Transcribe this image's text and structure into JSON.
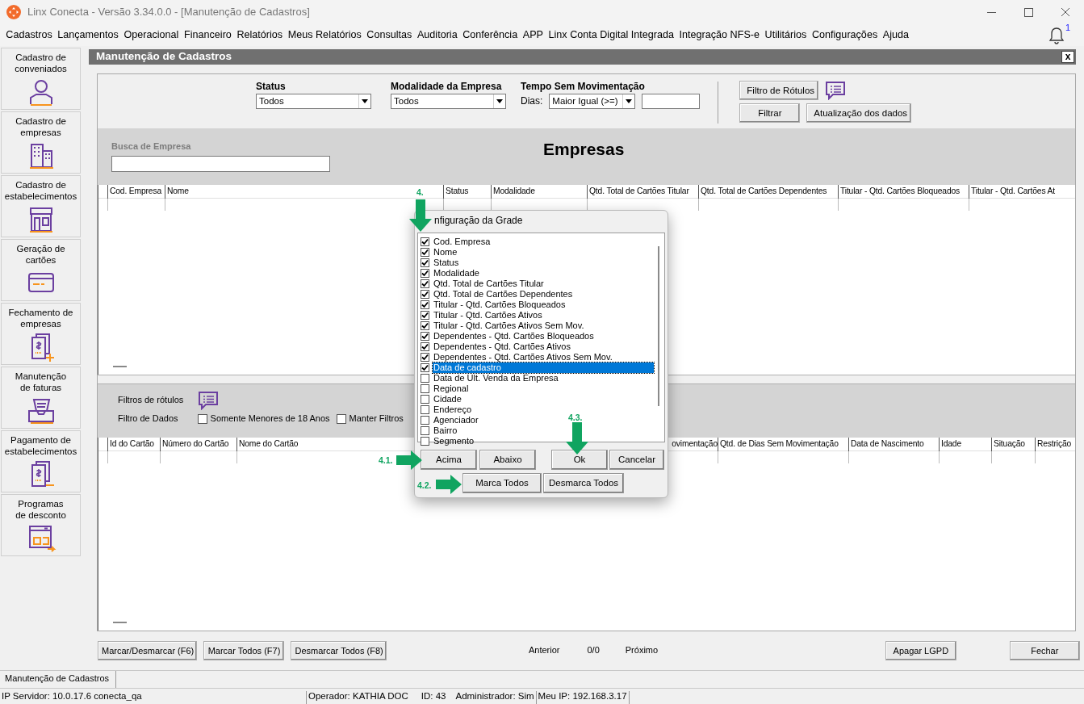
{
  "window": {
    "title": "Linx Conecta - Versão 3.34.0.0 - [Manutenção de Cadastros]"
  },
  "menu": [
    "Cadastros",
    "Lançamentos",
    "Operacional",
    "Financeiro",
    "Relatórios",
    "Meus Relatórios",
    "Consultas",
    "Auditoria",
    "Conferência",
    "APP",
    "Linx Conta Digital Integrada",
    "Integração NFS-e",
    "Utilitários",
    "Configurações",
    "Ajuda"
  ],
  "notifications": {
    "count": "1"
  },
  "sidebar": {
    "items": [
      {
        "label": "Cadastro de\nconveniados",
        "kind": "person"
      },
      {
        "label": "Cadastro de\nempresas",
        "kind": "buildings"
      },
      {
        "label": "Cadastro de\nestabelecimentos",
        "kind": "store"
      },
      {
        "label": "Geração de\ncartões",
        "kind": "card"
      },
      {
        "label": "Fechamento de\nempresas",
        "kind": "invoice-plus"
      },
      {
        "label": "Manutenção\nde faturas",
        "kind": "tray"
      },
      {
        "label": "Pagamento de\nestabelecimentos",
        "kind": "invoice-minus"
      },
      {
        "label": "Programas\nde desconto",
        "kind": "discount"
      }
    ]
  },
  "document": {
    "title": "Manutenção de Cadastros",
    "close": "x"
  },
  "filters": {
    "status": {
      "label": "Status",
      "value": "Todos"
    },
    "modalidade": {
      "label": "Modalidade da Empresa",
      "value": "Todos"
    },
    "tempo": {
      "label": "Tempo Sem Movimentação",
      "dias_label": "Dias:",
      "operator": "Maior Igual (>=)"
    },
    "buttons": [
      "Filtro de Rótulos",
      "Filtrar",
      "Atualização dos dados"
    ]
  },
  "search": {
    "label": "Busca de Empresa"
  },
  "heading": "Empresas",
  "companies_grid": {
    "columns": [
      "Cod. Empresa",
      "Nome",
      "Status",
      "Modalidade",
      "Qtd. Total de Cartões Titular",
      "Qtd. Total de Cartões Dependentes",
      "Titular - Qtd. Cartões Bloqueados",
      "Titular - Qtd. Cartões At"
    ]
  },
  "card_filters": {
    "label": "Filtros de rótulos",
    "data_label": "Filtro de Dados",
    "checkboxes": [
      {
        "label": "Somente Menores de 18 Anos",
        "checked": false
      },
      {
        "label": "Manter Filtros",
        "checked": false
      }
    ]
  },
  "cards_grid": {
    "columns": [
      "Id do Cartão",
      "Número do Cartão",
      "Nome do Cartão",
      "ovimentação",
      "Qtd. de Dias Sem Movimentação",
      "Data de Nascimento",
      "Idade",
      "Situação",
      "Restrição"
    ]
  },
  "footer": {
    "buttons": [
      "Marcar/Desmarcar (F6)",
      "Marcar Todos (F7)",
      "Desmarcar Todos (F8)"
    ],
    "previous": "Anterior",
    "count": "0/0",
    "next": "Próximo",
    "erase": "Apagar LGPD",
    "close": "Fechar"
  },
  "open_tabs": [
    "Manutenção de Cadastros"
  ],
  "status_bar": [
    "IP Servidor: 10.0.17.6 conecta_qa",
    "Operador: KATHIA DOC",
    "ID: 43",
    "Administrador: Sim",
    "Meu IP: 192.168.3.17"
  ],
  "dialog": {
    "title": "nfiguração da Grade",
    "items": [
      {
        "label": "Cod. Empresa",
        "checked": true,
        "selected": false
      },
      {
        "label": "Nome",
        "checked": true,
        "selected": false
      },
      {
        "label": "Status",
        "checked": true,
        "selected": false
      },
      {
        "label": "Modalidade",
        "checked": true,
        "selected": false
      },
      {
        "label": "Qtd. Total de Cartões Titular",
        "checked": true,
        "selected": false
      },
      {
        "label": "Qtd. Total de Cartões Dependentes",
        "checked": true,
        "selected": false
      },
      {
        "label": "Titular - Qtd. Cartões Bloqueados",
        "checked": true,
        "selected": false
      },
      {
        "label": "Titular - Qtd. Cartões Ativos",
        "checked": true,
        "selected": false
      },
      {
        "label": "Titular - Qtd. Cartões Ativos Sem Mov.",
        "checked": true,
        "selected": false
      },
      {
        "label": "Dependentes - Qtd. Cartões Bloqueados",
        "checked": true,
        "selected": false
      },
      {
        "label": "Dependentes - Qtd. Cartões Ativos",
        "checked": true,
        "selected": false
      },
      {
        "label": "Dependentes - Qtd. Cartões Ativos Sem Mov.",
        "checked": true,
        "selected": false
      },
      {
        "label": "Data de cadastro",
        "checked": true,
        "selected": true
      },
      {
        "label": "Data de Ult. Venda da Empresa",
        "checked": false,
        "selected": false
      },
      {
        "label": "Regional",
        "checked": false,
        "selected": false
      },
      {
        "label": "Cidade",
        "checked": false,
        "selected": false
      },
      {
        "label": "Endereço",
        "checked": false,
        "selected": false
      },
      {
        "label": "Agenciador",
        "checked": false,
        "selected": false
      },
      {
        "label": "Bairro",
        "checked": false,
        "selected": false
      },
      {
        "label": "Segmento",
        "checked": false,
        "selected": false
      }
    ],
    "buttons": [
      "Acima",
      "Abaixo",
      "Ok",
      "Cancelar",
      "Marca Todos",
      "Desmarca Todos"
    ]
  },
  "annotations": [
    {
      "label": "4.",
      "kind": "down"
    },
    {
      "label": "4.1.",
      "kind": "right"
    },
    {
      "label": "4.2.",
      "kind": "right"
    },
    {
      "label": "4.3.",
      "kind": "down"
    }
  ]
}
